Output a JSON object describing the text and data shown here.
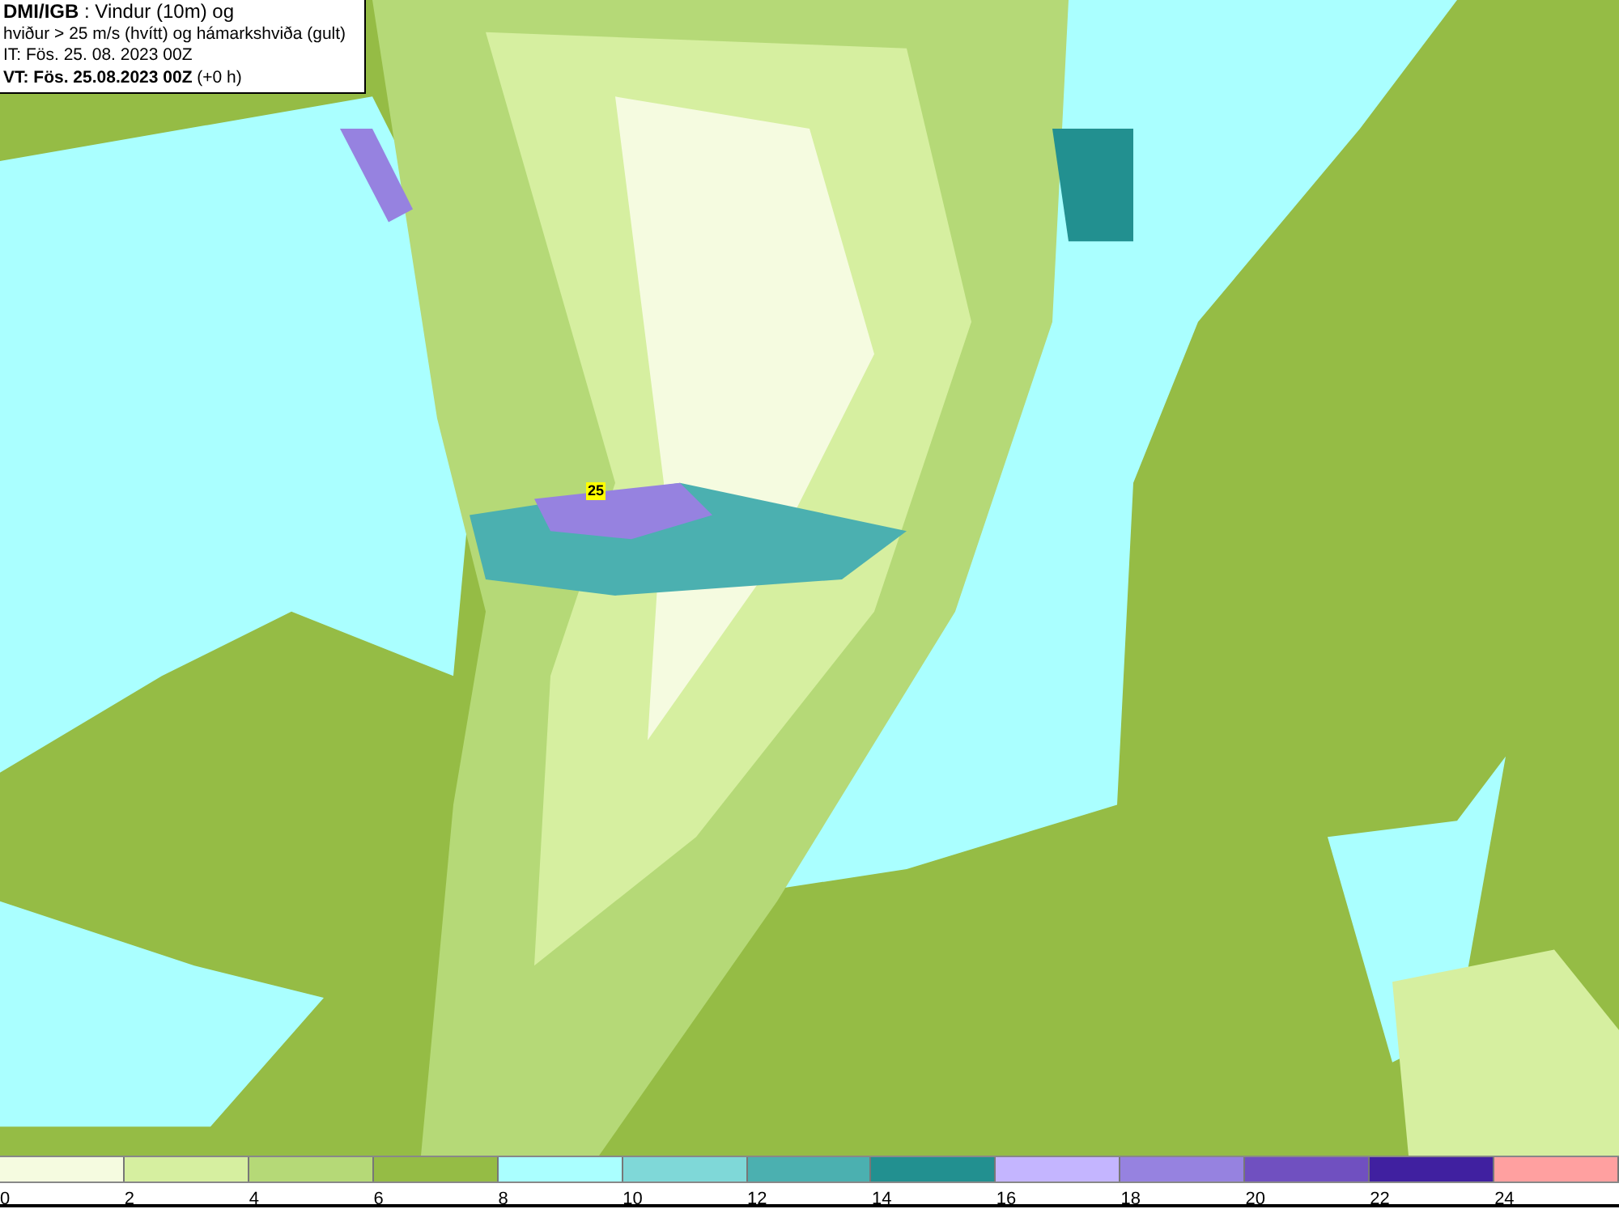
{
  "header": {
    "lines": [
      "**DMI/IGB** : Vindur (10m) og",
      "hviður > 25 m/s (hvítt) og hámarkshviða (gult)",
      "IT: Fös. 25. 08. 2023 00Z",
      "**VT: Fös. 25.08.2023 00Z** (+0 h)"
    ]
  },
  "map": {
    "markers": [
      {
        "label": "25"
      }
    ]
  },
  "legend": [
    {
      "label": "0",
      "color": "#f5fbe0"
    },
    {
      "label": "2",
      "color": "#d6efa0"
    },
    {
      "label": "4",
      "color": "#b5d977"
    },
    {
      "label": "6",
      "color": "#95bc45"
    },
    {
      "label": "8",
      "color": "#aaffff"
    },
    {
      "label": "10",
      "color": "#7fd8d8"
    },
    {
      "label": "12",
      "color": "#4bb0b0"
    },
    {
      "label": "14",
      "color": "#229090"
    },
    {
      "label": "16",
      "color": "#c4b5ff"
    },
    {
      "label": "18",
      "color": "#9682e0"
    },
    {
      "label": "20",
      "color": "#7050c0"
    },
    {
      "label": "22",
      "color": "#4020a0"
    },
    {
      "label": "24",
      "color": "#ffa0a0"
    }
  ]
}
